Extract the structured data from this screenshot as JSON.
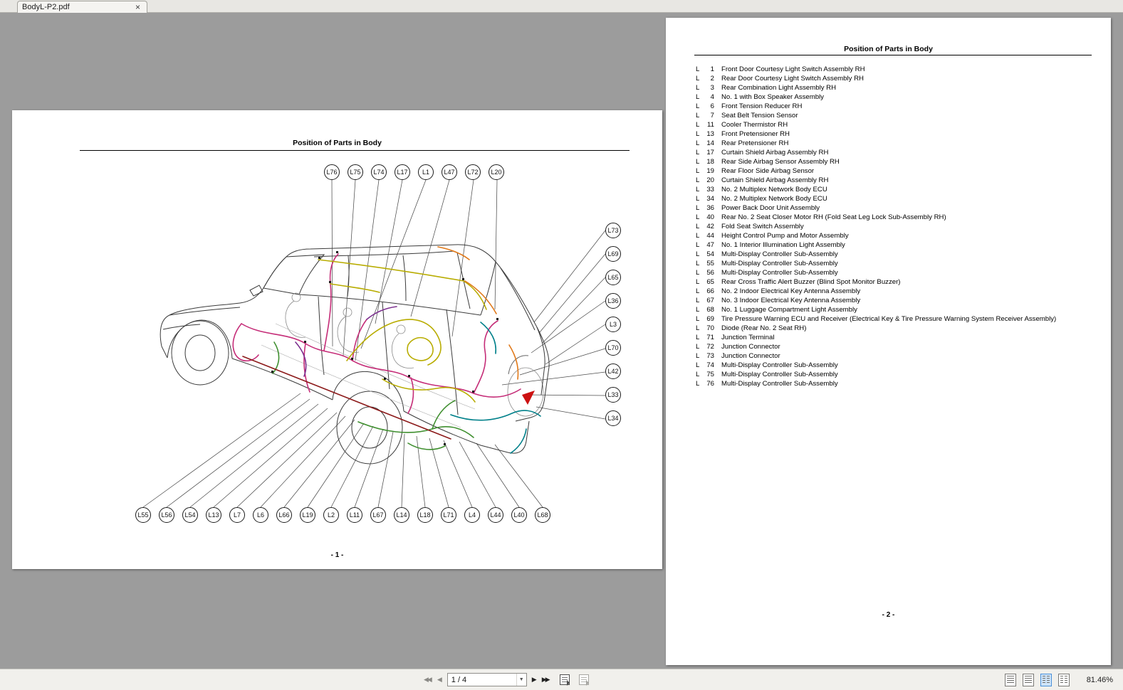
{
  "window": {
    "tab_title": "BodyL-P2.pdf",
    "close_glyph": "×"
  },
  "page1": {
    "title": "Position of Parts in Body",
    "page_number": "- 1 -",
    "callouts_top": [
      "L76",
      "L75",
      "L74",
      "L17",
      "L1",
      "L47",
      "L72",
      "L20"
    ],
    "callouts_right": [
      "L73",
      "L69",
      "L65",
      "L36",
      "L3",
      "L70",
      "L42",
      "L33",
      "L34"
    ],
    "callouts_bottom": [
      "L55",
      "L56",
      "L54",
      "L13",
      "L7",
      "L6",
      "L66",
      "L19",
      "L2",
      "L11",
      "L67",
      "L14",
      "L18",
      "L71",
      "L4",
      "L44",
      "L40",
      "L68"
    ]
  },
  "page2": {
    "title": "Position of Parts in Body",
    "page_number": "- 2 -",
    "parts": [
      {
        "prefix": "L",
        "num": "1",
        "desc": "Front Door Courtesy Light Switch Assembly RH"
      },
      {
        "prefix": "L",
        "num": "2",
        "desc": "Rear Door Courtesy Light Switch Assembly RH"
      },
      {
        "prefix": "L",
        "num": "3",
        "desc": "Rear Combination Light Assembly RH"
      },
      {
        "prefix": "L",
        "num": "4",
        "desc": "No. 1 with Box Speaker Assembly"
      },
      {
        "prefix": "L",
        "num": "6",
        "desc": "Front Tension Reducer RH"
      },
      {
        "prefix": "L",
        "num": "7",
        "desc": "Seat Belt Tension Sensor"
      },
      {
        "prefix": "L",
        "num": "11",
        "desc": "Cooler Thermistor RH"
      },
      {
        "prefix": "L",
        "num": "13",
        "desc": "Front Pretensioner RH"
      },
      {
        "prefix": "L",
        "num": "14",
        "desc": "Rear Pretensioner RH"
      },
      {
        "prefix": "L",
        "num": "17",
        "desc": "Curtain Shield Airbag Assembly RH"
      },
      {
        "prefix": "L",
        "num": "18",
        "desc": "Rear Side Airbag Sensor Assembly RH"
      },
      {
        "prefix": "L",
        "num": "19",
        "desc": "Rear Floor Side Airbag Sensor"
      },
      {
        "prefix": "L",
        "num": "20",
        "desc": "Curtain Shield Airbag Assembly RH"
      },
      {
        "prefix": "L",
        "num": "33",
        "desc": "No. 2 Multiplex Network Body ECU"
      },
      {
        "prefix": "L",
        "num": "34",
        "desc": "No. 2 Multiplex Network Body ECU"
      },
      {
        "prefix": "L",
        "num": "36",
        "desc": "Power Back Door Unit Assembly"
      },
      {
        "prefix": "L",
        "num": "40",
        "desc": "Rear No. 2 Seat Closer Motor RH (Fold Seat Leg Lock Sub-Assembly RH)"
      },
      {
        "prefix": "L",
        "num": "42",
        "desc": "Fold Seat Switch Assembly"
      },
      {
        "prefix": "L",
        "num": "44",
        "desc": "Height Control Pump and Motor Assembly"
      },
      {
        "prefix": "L",
        "num": "47",
        "desc": "No. 1 Interior Illumination Light Assembly"
      },
      {
        "prefix": "L",
        "num": "54",
        "desc": "Multi-Display Controller Sub-Assembly"
      },
      {
        "prefix": "L",
        "num": "55",
        "desc": "Multi-Display Controller Sub-Assembly"
      },
      {
        "prefix": "L",
        "num": "56",
        "desc": "Multi-Display Controller Sub-Assembly"
      },
      {
        "prefix": "L",
        "num": "65",
        "desc": "Rear Cross Traffic Alert Buzzer (Blind Spot Monitor Buzzer)"
      },
      {
        "prefix": "L",
        "num": "66",
        "desc": "No. 2 Indoor Electrical Key Antenna Assembly"
      },
      {
        "prefix": "L",
        "num": "67",
        "desc": "No. 3 Indoor Electrical Key Antenna Assembly"
      },
      {
        "prefix": "L",
        "num": "68",
        "desc": "No. 1 Luggage Compartment Light Assembly"
      },
      {
        "prefix": "L",
        "num": "69",
        "desc": "Tire Pressure Warning ECU and Receiver (Electrical Key & Tire Pressure Warning System Receiver Assembly)"
      },
      {
        "prefix": "L",
        "num": "70",
        "desc": "Diode (Rear No. 2 Seat RH)"
      },
      {
        "prefix": "L",
        "num": "71",
        "desc": "Junction Terminal"
      },
      {
        "prefix": "L",
        "num": "72",
        "desc": "Junction Connector"
      },
      {
        "prefix": "L",
        "num": "73",
        "desc": "Junction Connector"
      },
      {
        "prefix": "L",
        "num": "74",
        "desc": "Multi-Display Controller Sub-Assembly"
      },
      {
        "prefix": "L",
        "num": "75",
        "desc": "Multi-Display Controller Sub-Assembly"
      },
      {
        "prefix": "L",
        "num": "76",
        "desc": "Multi-Display Controller Sub-Assembly"
      }
    ]
  },
  "toolbar": {
    "first_glyph": "◀◀",
    "prev_glyph": "◀",
    "next_glyph": "▶",
    "last_glyph": "▶▶",
    "dropdown_glyph": "▼",
    "page_field": "1 / 4",
    "zoom_label": "81.46%"
  },
  "colors": {
    "selection_blue": "#cfe4f8",
    "harness_magenta": "#c52d78",
    "harness_yellow": "#b8ac00",
    "harness_green": "#3f8f2f",
    "harness_teal": "#00808a",
    "harness_orange": "#e07818",
    "harness_darkred": "#8c1a1a",
    "harness_purple": "#7b2d8e",
    "arrow_red": "#cc1111"
  }
}
